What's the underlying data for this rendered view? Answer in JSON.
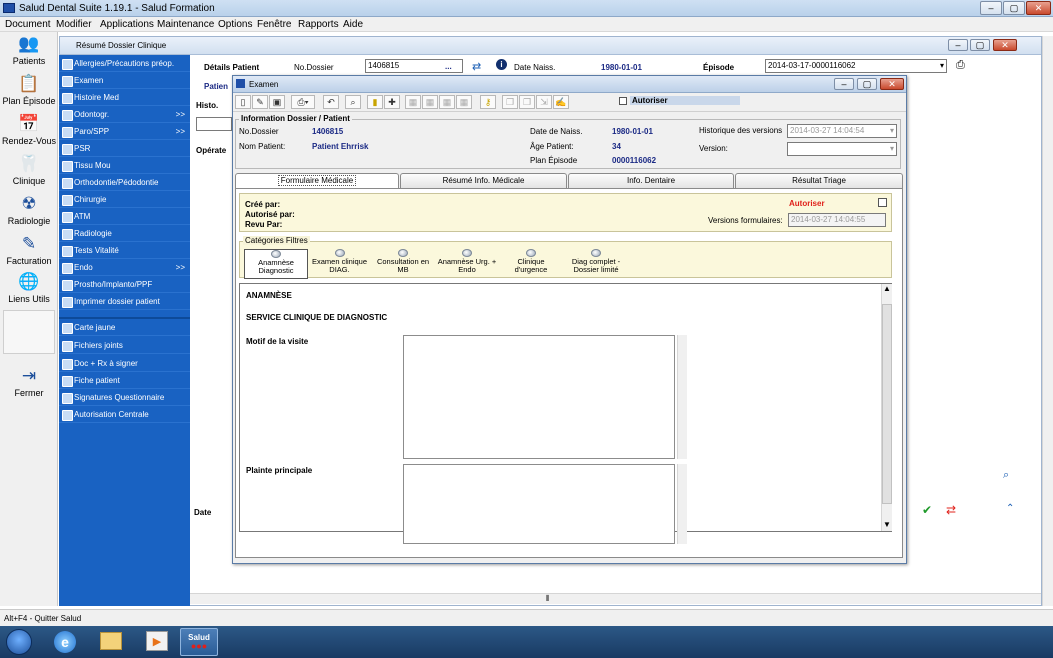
{
  "app": {
    "title": "Salud Dental Suite 1.19.1 - Salud Formation"
  },
  "menu": [
    "Document",
    "Modifier",
    "Applications",
    "Maintenance",
    "Options",
    "Fenêtre",
    "Rapports",
    "Aide"
  ],
  "left_toolbar": [
    {
      "label": "Patients",
      "icon": "patients-icon"
    },
    {
      "label": "Plan Épisode",
      "icon": "plan-episode-icon"
    },
    {
      "label": "Rendez-Vous",
      "icon": "calendar-icon"
    },
    {
      "label": "Clinique",
      "icon": "tooth-icon"
    },
    {
      "label": "Radiologie",
      "icon": "xray-icon"
    },
    {
      "label": "Facturation",
      "icon": "billing-icon"
    },
    {
      "label": "Liens Utils",
      "icon": "globe-icon"
    },
    {
      "label": "Fermer",
      "icon": "exit-icon"
    }
  ],
  "side_menu": [
    {
      "label": "Allergies/Précautions préop.",
      "arrow": ""
    },
    {
      "label": "Examen",
      "arrow": ""
    },
    {
      "label": "Histoire Med",
      "arrow": ""
    },
    {
      "label": "Odontogr.",
      "arrow": ">>"
    },
    {
      "label": "Paro/SPP",
      "arrow": ">>"
    },
    {
      "label": "PSR",
      "arrow": ""
    },
    {
      "label": "Tissu Mou",
      "arrow": ""
    },
    {
      "label": "Orthodontie/Pédodontie",
      "arrow": ""
    },
    {
      "label": "Chirurgie",
      "arrow": ""
    },
    {
      "label": "ATM",
      "arrow": ""
    },
    {
      "label": "Radiologie",
      "arrow": ""
    },
    {
      "label": "Tests Vitalité",
      "arrow": ""
    },
    {
      "label": "Endo",
      "arrow": ">>"
    },
    {
      "label": "Prostho/Implanto/PPF",
      "arrow": ""
    },
    {
      "label": "Imprimer dossier patient",
      "arrow": ""
    },
    {
      "label": "Carte jaune",
      "arrow": ""
    },
    {
      "label": "Fichiers joints",
      "arrow": ""
    },
    {
      "label": "Doc + Rx à signer",
      "arrow": ""
    },
    {
      "label": "Fiche patient",
      "arrow": ""
    },
    {
      "label": "Signatures Questionnaire",
      "arrow": ""
    },
    {
      "label": "Autorisation Centrale",
      "arrow": ""
    }
  ],
  "inner": {
    "title": "Résumé Dossier Clinique",
    "details_label": "Détails Patient",
    "no_dossier_label": "No.Dossier",
    "no_dossier_value": "1406815",
    "ellipsis": "...",
    "date_naiss_label": "Date Naiss.",
    "date_naiss_value": "1980-01-01",
    "episode_label": "Épisode",
    "episode_value": "2014-03-17-0000116062",
    "patient_cut": "Patien",
    "histo_cut": "Histo.",
    "operate_cut": "Opérate",
    "date_label": "Date"
  },
  "dialog": {
    "title": "Examen",
    "autoriser_label": "Autoriser",
    "info_group": "Information Dossier / Patient",
    "no_dossier_label": "No.Dossier",
    "no_dossier_value": "1406815",
    "nom_label": "Nom Patient:",
    "nom_value": "Patient Ehrrisk",
    "date_naiss_label": "Date de Naiss.",
    "date_naiss_value": "1980-01-01",
    "age_label": "Âge Patient:",
    "age_value": "34",
    "plan_label": "Plan Épisode",
    "plan_value": "0000116062",
    "historique_label": "Historique des versions",
    "historique_value": "2014-03-27 14:04:54",
    "version_label": "Version:",
    "version_value": "",
    "tabs": [
      "Formulaire Médicale",
      "Résumé Info. Médicale",
      "Info. Dentaire",
      "Résultat Triage"
    ],
    "cree_par": "Créé par:",
    "autorise_par": "Autorisé par:",
    "revu_par": "Revu Par:",
    "autoriser_red": "Autoriser",
    "versions_form_label": "Versions formulaires:",
    "versions_form_value": "2014-03-27 14:04:55",
    "categories_label": "Catégories Filtres",
    "filters": [
      "Anamnèse Diagnostic",
      "Examen clinique DIAG.",
      "Consultation en MB",
      "Anamnèse Urg. + Endo",
      "Clinique d'urgence",
      "Diag complet - Dossier limité"
    ],
    "section_title": "ANAMNÈSE",
    "service_title": "SERVICE CLINIQUE DE DIAGNOSTIC",
    "motif_label": "Motif de la visite",
    "plainte_label": "Plainte principale"
  },
  "status": {
    "text": "Alt+F4 - Quitter Salud"
  },
  "taskbar": {
    "salud_label": "Salud"
  },
  "colors": {
    "side_menu": "#1962c2",
    "navy": "#1b2a85",
    "red": "#e0201a"
  }
}
